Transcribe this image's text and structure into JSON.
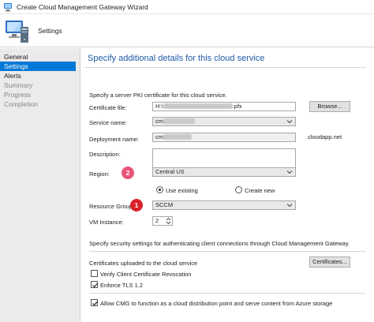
{
  "window": {
    "title": "Create Cloud Management Gateway Wizard"
  },
  "header": {
    "label": "Settings"
  },
  "sidebar": {
    "items": [
      {
        "label": "General",
        "state": "normal"
      },
      {
        "label": "Settings",
        "state": "selected"
      },
      {
        "label": "Alerts",
        "state": "normal"
      },
      {
        "label": "Summary",
        "state": "disabled"
      },
      {
        "label": "Progress",
        "state": "disabled"
      },
      {
        "label": "Completion",
        "state": "disabled"
      }
    ]
  },
  "page": {
    "heading": "Specify additional details for this cloud service",
    "intro": "Specify a server PKI certificate for this cloud service.",
    "certificate_file": {
      "label": "Certificate file:",
      "prefix": "H:\\",
      "suffix": ".pfx",
      "browse_label": "Browse..."
    },
    "service_name": {
      "label": "Service name:",
      "value": "cm"
    },
    "deployment_name": {
      "label": "Deployment name:",
      "value": "cm",
      "suffix": ".cloudapp.net"
    },
    "description": {
      "label": "Description:",
      "value": ""
    },
    "region": {
      "label": "Region:",
      "value": "Central US",
      "badge": "2"
    },
    "resource_group_mode": {
      "use_existing": "Use existing",
      "create_new": "Create new",
      "selected": "use_existing"
    },
    "resource_group": {
      "label": "Resource Group:",
      "value": "SCCM",
      "badge": "1"
    },
    "vm_instance": {
      "label": "VM Instance:",
      "value": "2"
    },
    "security_intro": "Specify security settings for authenticating client connections through Cloud Management Gateway.",
    "certificates": {
      "label": "Certificates uploaded to the cloud service",
      "button": "Certificates..."
    },
    "verify_crl": {
      "label": "Verify Client Certificate Revocation",
      "checked": false
    },
    "enforce_tls": {
      "label": "Enforce TLS 1.2",
      "checked": true
    },
    "allow_cmg": {
      "label": "Allow CMG to function as a cloud distribution point and serve content from Azure storage",
      "checked": true
    }
  },
  "colors": {
    "accent": "#0078d7",
    "heading": "#1e5aa8",
    "badge_2": "#e8547a",
    "badge_1": "#d9222a"
  },
  "icons": {
    "window": "wizard-computer-icon",
    "dropdown": "chevron-down-icon",
    "check": "checkmark-icon",
    "spin": "spin-up-down-icon"
  }
}
